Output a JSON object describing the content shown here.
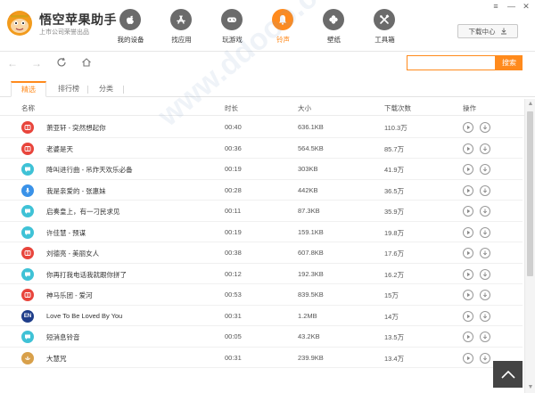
{
  "brand": {
    "title": "悟空苹果助手",
    "subtitle": "上市公司荣誉出品"
  },
  "nav": [
    {
      "label": "我的设备",
      "icon": "apple-icon",
      "active": false
    },
    {
      "label": "找应用",
      "icon": "app-store-icon",
      "active": false
    },
    {
      "label": "玩游戏",
      "icon": "gamepad-icon",
      "active": false
    },
    {
      "label": "铃声",
      "icon": "bell-icon",
      "active": true
    },
    {
      "label": "壁纸",
      "icon": "clover-icon",
      "active": false
    },
    {
      "label": "工具箱",
      "icon": "tools-icon",
      "active": false
    }
  ],
  "download_center": {
    "label": "下载中心"
  },
  "window_controls": {
    "menu": "≡",
    "minimize": "—",
    "close": "✕"
  },
  "search": {
    "placeholder": "",
    "value": "",
    "button": "搜索"
  },
  "tabs": [
    {
      "label": "精选",
      "active": true
    },
    {
      "label": "排行榜",
      "active": false
    },
    {
      "label": "分类",
      "active": false
    }
  ],
  "table": {
    "headers": {
      "name": "名称",
      "duration": "时长",
      "size": "大小",
      "downloads": "下载次数",
      "actions": "操作"
    },
    "rows": [
      {
        "name": "萧亚轩 - 突然想起你",
        "duration": "00:40",
        "size": "636.1KB",
        "downloads": "110.3万",
        "icon": "music-icon",
        "color": "#e8453c"
      },
      {
        "name": "老婆是天",
        "duration": "00:36",
        "size": "564.5KB",
        "downloads": "85.7万",
        "icon": "music-icon",
        "color": "#e8453c"
      },
      {
        "name": "降叫进行曲 - 吊炸天欢乐必备",
        "duration": "00:19",
        "size": "303KB",
        "downloads": "41.9万",
        "icon": "chat-icon",
        "color": "#3fc2d6"
      },
      {
        "name": "我是亲爱的 - 张惠妹",
        "duration": "00:28",
        "size": "442KB",
        "downloads": "36.5万",
        "icon": "mic-icon",
        "color": "#3a92e8"
      },
      {
        "name": "启奏皇上，有一刁民求见",
        "duration": "00:11",
        "size": "87.3KB",
        "downloads": "35.9万",
        "icon": "chat-icon",
        "color": "#3fc2d6"
      },
      {
        "name": "许佳慧 - 预谋",
        "duration": "00:19",
        "size": "159.1KB",
        "downloads": "19.8万",
        "icon": "chat-icon",
        "color": "#3fc2d6"
      },
      {
        "name": "刘德亮 - 美丽女人",
        "duration": "00:38",
        "size": "607.8KB",
        "downloads": "17.6万",
        "icon": "music-icon",
        "color": "#e8453c"
      },
      {
        "name": "你再打我电话我就跟你拼了",
        "duration": "00:12",
        "size": "192.3KB",
        "downloads": "16.2万",
        "icon": "chat-icon",
        "color": "#3fc2d6"
      },
      {
        "name": "神马乐团 - 爱河",
        "duration": "00:53",
        "size": "839.5KB",
        "downloads": "15万",
        "icon": "music-icon",
        "color": "#e8453c"
      },
      {
        "name": "Love To Be Loved By You",
        "duration": "00:31",
        "size": "1.2MB",
        "downloads": "14万",
        "icon": "en-icon",
        "badge": "EN",
        "color": "#1f3e8a"
      },
      {
        "name": "短消息铃音",
        "duration": "00:05",
        "size": "43.2KB",
        "downloads": "13.5万",
        "icon": "chat-icon",
        "color": "#3fc2d6"
      },
      {
        "name": "大慧咒",
        "duration": "00:31",
        "size": "239.9KB",
        "downloads": "13.4万",
        "icon": "lotus-icon",
        "color": "#d8a04a"
      }
    ]
  },
  "colors": {
    "accent": "#ff8a1c",
    "nav_icon": "#6b6b6b"
  }
}
